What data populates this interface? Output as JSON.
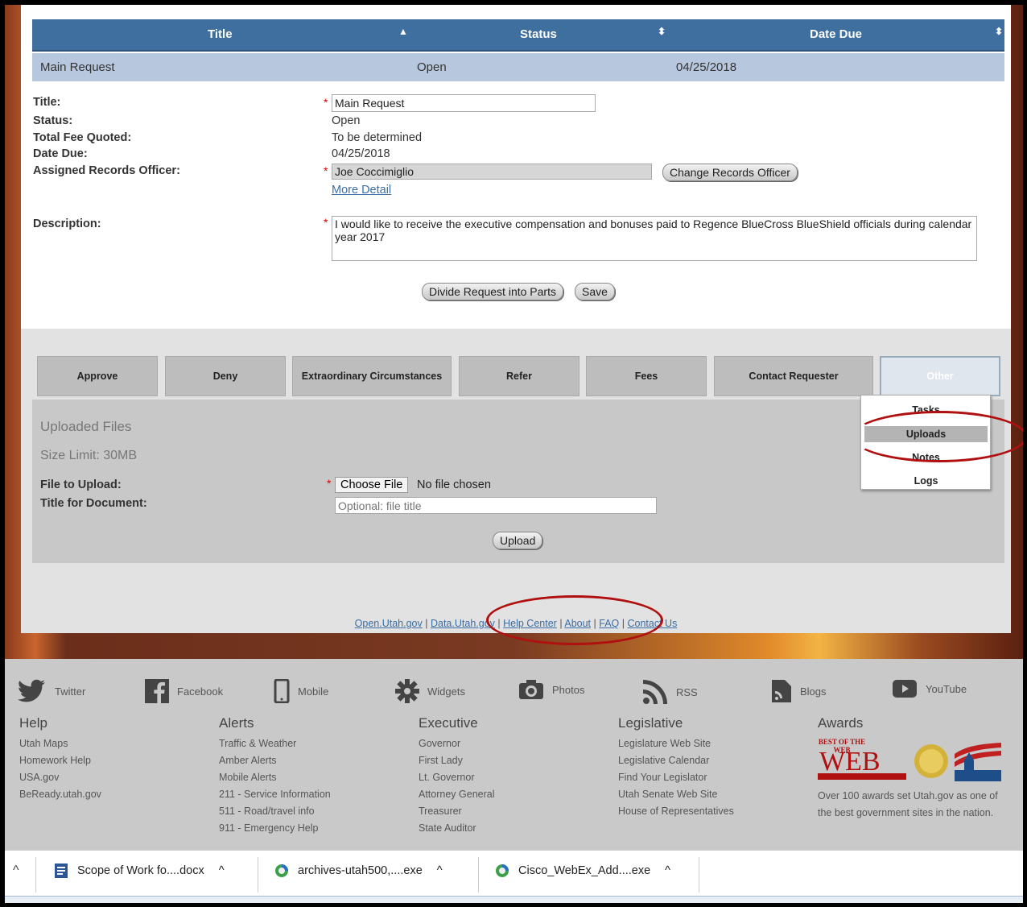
{
  "grid": {
    "headers": [
      "Title",
      "Status",
      "Date Due"
    ],
    "row": {
      "title": "Main Request",
      "status": "Open",
      "date_due": "04/25/2018"
    }
  },
  "form": {
    "title_label": "Title:",
    "title_value": "Main Request",
    "status_label": "Status:",
    "status_value": "Open",
    "fee_label": "Total Fee Quoted:",
    "fee_value": "To be determined",
    "due_label": "Date Due:",
    "due_value": "04/25/2018",
    "officer_label": "Assigned Records Officer:",
    "officer_value": "Joe Coccimiglio",
    "change_officer_button": "Change Records Officer",
    "more_detail_link": "More Detail",
    "description_label": "Description:",
    "description_value": "I would like to receive the executive compensation and bonuses paid to Regence BlueCross BlueShield officials during calendar year 2017",
    "divide_button": "Divide Request into Parts",
    "save_button": "Save",
    "required_mark": "*"
  },
  "actions": [
    "Approve",
    "Deny",
    "Extraordinary Circumstances",
    "Refer",
    "Fees",
    "Contact Requester",
    "Other"
  ],
  "other_menu": [
    "Tasks",
    "Uploads",
    "Notes",
    "Logs"
  ],
  "uploads": {
    "heading": "Uploaded Files",
    "size_limit": "Size Limit: 30MB",
    "file_label": "File to Upload:",
    "choose_file_button": "Choose File",
    "no_file_text": "No file chosen",
    "doc_title_label": "Title for Document:",
    "doc_title_placeholder": "Optional: file title",
    "upload_button": "Upload"
  },
  "footer_links": [
    "Open.Utah.gov",
    "Data.Utah.gov",
    "Help Center",
    "About",
    "FAQ",
    "Contact Us"
  ],
  "footer_sep": "|",
  "social": [
    {
      "label": "Twitter",
      "icon": "twitter-icon"
    },
    {
      "label": "Facebook",
      "icon": "facebook-icon"
    },
    {
      "label": "Mobile",
      "icon": "mobile-icon"
    },
    {
      "label": "Widgets",
      "icon": "gear-icon"
    },
    {
      "label": "Photos",
      "icon": "camera-icon"
    },
    {
      "label": "RSS",
      "icon": "rss-icon"
    },
    {
      "label": "Blogs",
      "icon": "blog-icon"
    },
    {
      "label": "YouTube",
      "icon": "youtube-icon"
    }
  ],
  "footer_columns": {
    "help": {
      "title": "Help",
      "items": [
        "Utah Maps",
        "Homework Help",
        "USA.gov",
        "BeReady.utah.gov"
      ]
    },
    "alerts": {
      "title": "Alerts",
      "items": [
        "Traffic & Weather",
        "Amber Alerts",
        "Mobile Alerts",
        "211 - Service Information",
        "511 - Road/travel info",
        "911 - Emergency Help"
      ]
    },
    "executive": {
      "title": "Executive",
      "items": [
        "Governor",
        "First Lady",
        "Lt. Governor",
        "Attorney General",
        "Treasurer",
        "State Auditor"
      ]
    },
    "legislative": {
      "title": "Legislative",
      "items": [
        "Legislature Web Site",
        "Legislative Calendar",
        "Find Your Legislator",
        "Utah Senate Web Site",
        "House of Representatives"
      ]
    },
    "awards": {
      "title": "Awards",
      "logo_text": "BEST OF THE WEB",
      "text": "Over 100 awards set Utah.gov as one of the best government sites in the nation."
    }
  },
  "taskbar": {
    "items": [
      {
        "label": "Scope of Work fo....docx",
        "icon": "word-doc-icon"
      },
      {
        "label": "archives-utah500,....exe",
        "icon": "installer-icon"
      },
      {
        "label": "Cisco_WebEx_Add....exe",
        "icon": "installer-icon"
      }
    ],
    "chevron": "^"
  },
  "colors": {
    "header_blue": "#3f6f9e",
    "row_blue": "#b7c8de",
    "annotation_red": "#b01010",
    "link_blue": "#3b6ea5"
  }
}
